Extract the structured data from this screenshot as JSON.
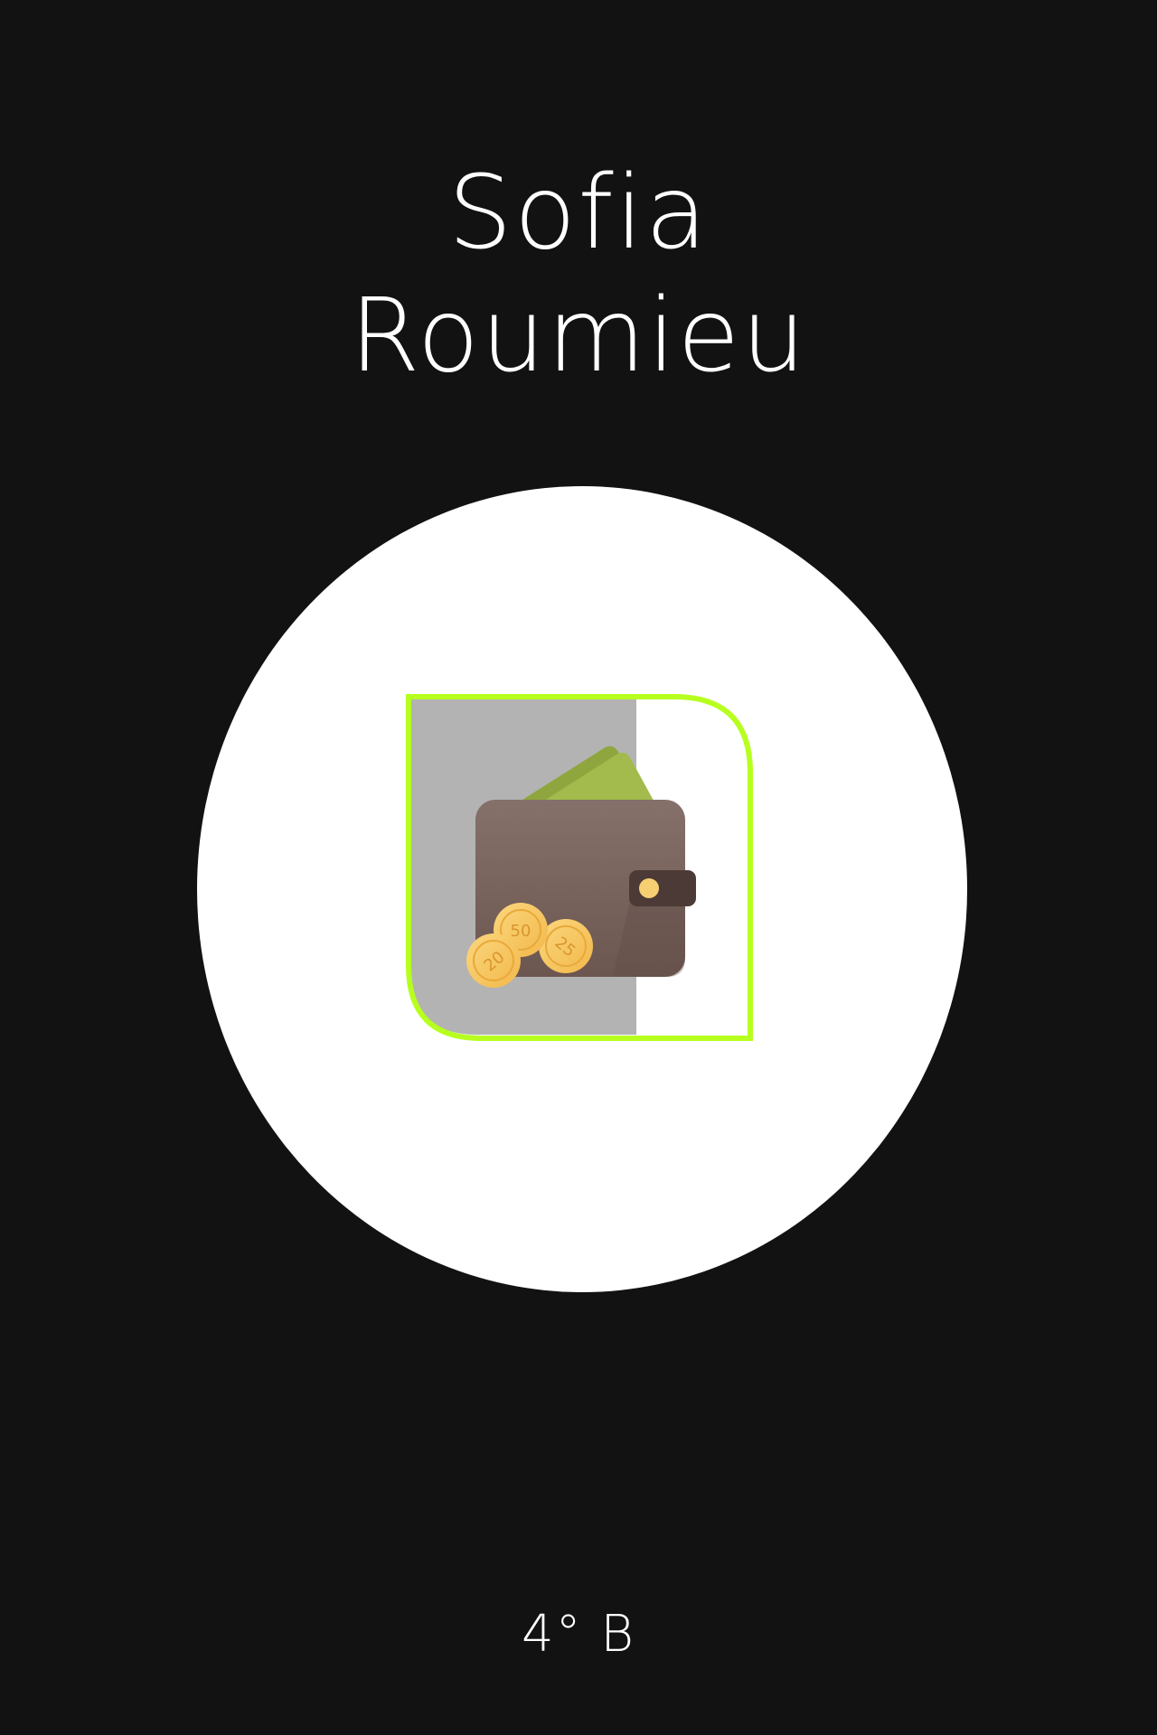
{
  "student": {
    "first_name": "Sofia",
    "last_name": "Roumieu"
  },
  "emblem": {
    "icon": "wallet-with-coins-icon",
    "coins": [
      "20",
      "50",
      "25"
    ]
  },
  "grade": "4° B",
  "colors": {
    "background": "#121212",
    "circle": "#ffffff",
    "accent": "#b7ff1f",
    "panel": "#b3b3b3",
    "wallet": "#7a625b",
    "bill": "#9db54a",
    "coin": "#f7c65c"
  }
}
